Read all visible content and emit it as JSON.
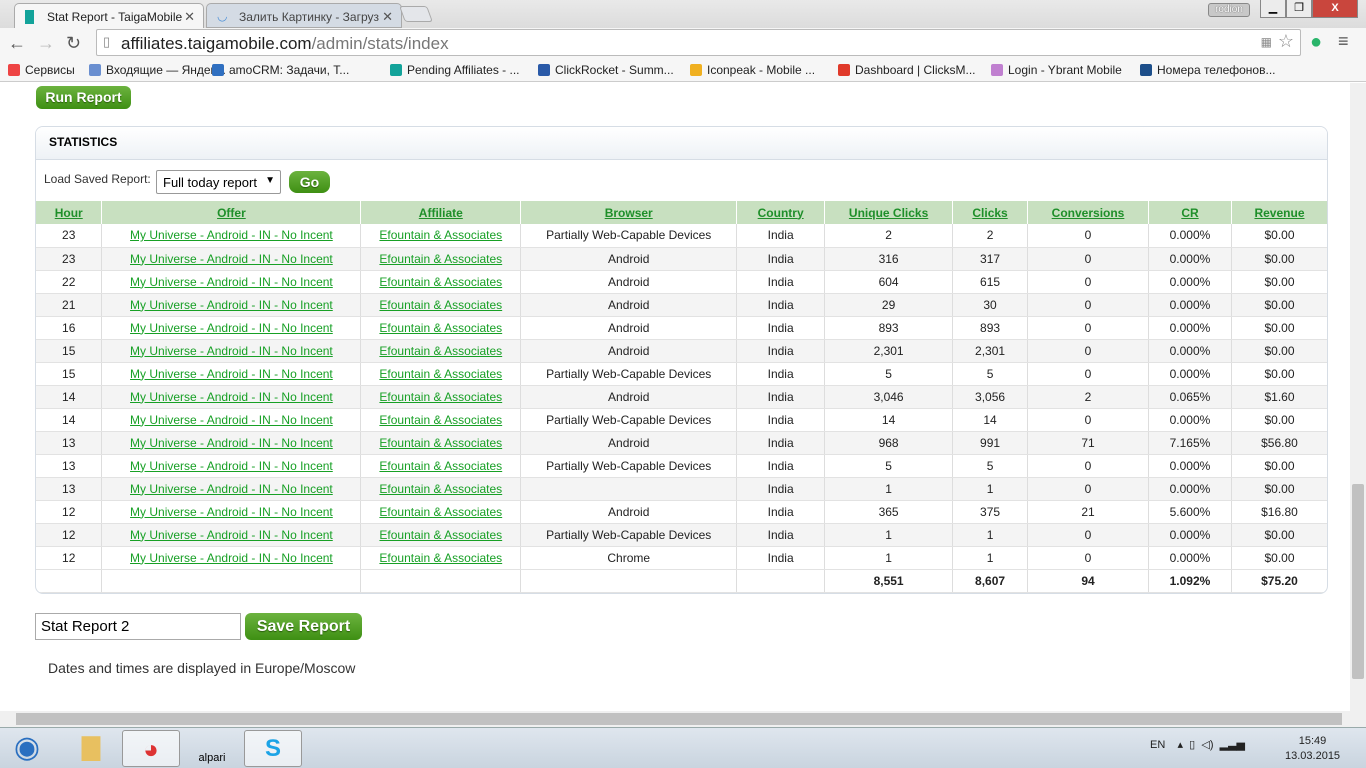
{
  "browser": {
    "tabs": [
      {
        "label": "Stat Report - TaigaMobile"
      },
      {
        "label": "Залить Картинку - Загруз"
      }
    ],
    "user": "rodion",
    "url_host": "affiliates.taigamobile.com",
    "url_path": "/admin/stats/index",
    "bookmarks": [
      {
        "label": "Сервисы",
        "color": "#e44"
      },
      {
        "label": "Входящие — Яндек...",
        "color": "#6a8fd0"
      },
      {
        "label": "amoCRM: Задачи, Т...",
        "color": "#2f6fc0"
      },
      {
        "label": "Pending Affiliates - ...",
        "color": "#13a39a"
      },
      {
        "label": "ClickRocket - Summ...",
        "color": "#2a5aa8"
      },
      {
        "label": "Iconpeak - Mobile ...",
        "color": "#f0b020"
      },
      {
        "label": "Dashboard | ClicksM...",
        "color": "#e03a2a"
      },
      {
        "label": "Login - Ybrant Mobile",
        "color": "#c080d0"
      },
      {
        "label": "Номера телефонов...",
        "color": "#1d4f8a"
      }
    ]
  },
  "page": {
    "run_report": "Run Report",
    "panel_title": "STATISTICS",
    "load_label": "Load Saved Report:",
    "saved_report": "Full today report",
    "go": "Go",
    "columns": [
      "Hour",
      "Offer",
      "Affiliate",
      "Browser",
      "Country",
      "Unique Clicks",
      "Clicks",
      "Conversions",
      "CR",
      "Revenue"
    ],
    "rows": [
      [
        "23",
        "My Universe - Android - IN - No Incent",
        "Efountain & Associates",
        "Partially Web-Capable Devices",
        "India",
        "2",
        "2",
        "0",
        "0.000%",
        "$0.00"
      ],
      [
        "23",
        "My Universe - Android - IN - No Incent",
        "Efountain & Associates",
        "Android",
        "India",
        "316",
        "317",
        "0",
        "0.000%",
        "$0.00"
      ],
      [
        "22",
        "My Universe - Android - IN - No Incent",
        "Efountain & Associates",
        "Android",
        "India",
        "604",
        "615",
        "0",
        "0.000%",
        "$0.00"
      ],
      [
        "21",
        "My Universe - Android - IN - No Incent",
        "Efountain & Associates",
        "Android",
        "India",
        "29",
        "30",
        "0",
        "0.000%",
        "$0.00"
      ],
      [
        "16",
        "My Universe - Android - IN - No Incent",
        "Efountain & Associates",
        "Android",
        "India",
        "893",
        "893",
        "0",
        "0.000%",
        "$0.00"
      ],
      [
        "15",
        "My Universe - Android - IN - No Incent",
        "Efountain & Associates",
        "Android",
        "India",
        "2,301",
        "2,301",
        "0",
        "0.000%",
        "$0.00"
      ],
      [
        "15",
        "My Universe - Android - IN - No Incent",
        "Efountain & Associates",
        "Partially Web-Capable Devices",
        "India",
        "5",
        "5",
        "0",
        "0.000%",
        "$0.00"
      ],
      [
        "14",
        "My Universe - Android - IN - No Incent",
        "Efountain & Associates",
        "Android",
        "India",
        "3,046",
        "3,056",
        "2",
        "0.065%",
        "$1.60"
      ],
      [
        "14",
        "My Universe - Android - IN - No Incent",
        "Efountain & Associates",
        "Partially Web-Capable Devices",
        "India",
        "14",
        "14",
        "0",
        "0.000%",
        "$0.00"
      ],
      [
        "13",
        "My Universe - Android - IN - No Incent",
        "Efountain & Associates",
        "Android",
        "India",
        "968",
        "991",
        "71",
        "7.165%",
        "$56.80"
      ],
      [
        "13",
        "My Universe - Android - IN - No Incent",
        "Efountain & Associates",
        "Partially Web-Capable Devices",
        "India",
        "5",
        "5",
        "0",
        "0.000%",
        "$0.00"
      ],
      [
        "13",
        "My Universe - Android - IN - No Incent",
        "Efountain & Associates",
        "",
        "India",
        "1",
        "1",
        "0",
        "0.000%",
        "$0.00"
      ],
      [
        "12",
        "My Universe - Android - IN - No Incent",
        "Efountain & Associates",
        "Android",
        "India",
        "365",
        "375",
        "21",
        "5.600%",
        "$16.80"
      ],
      [
        "12",
        "My Universe - Android - IN - No Incent",
        "Efountain & Associates",
        "Partially Web-Capable Devices",
        "India",
        "1",
        "1",
        "0",
        "0.000%",
        "$0.00"
      ],
      [
        "12",
        "My Universe - Android - IN - No Incent",
        "Efountain & Associates",
        "Chrome",
        "India",
        "1",
        "1",
        "0",
        "0.000%",
        "$0.00"
      ]
    ],
    "totals": [
      "",
      "",
      "",
      "",
      "",
      "8,551",
      "8,607",
      "94",
      "1.092%",
      "$75.20"
    ],
    "report_name": "Stat Report 2",
    "save_report": "Save Report",
    "timezone_note": "Dates and times are displayed in Europe/Moscow"
  },
  "taskbar": {
    "alpari": "alpari",
    "lang": "EN",
    "time": "15:49",
    "date": "13.03.2015"
  }
}
